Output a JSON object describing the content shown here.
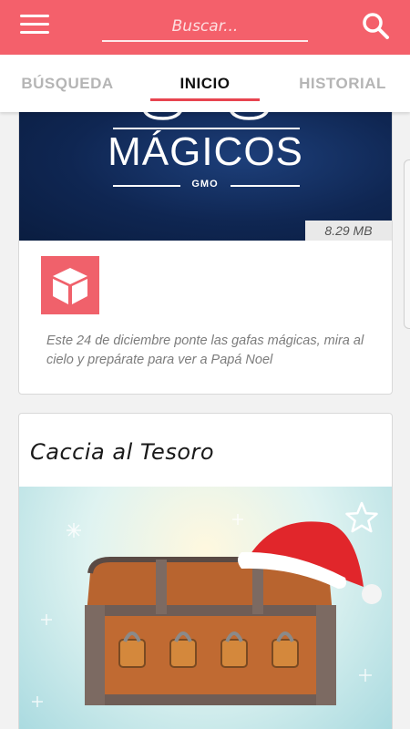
{
  "header": {
    "search_placeholder": "Buscar...",
    "menu_icon": "hamburger-menu-icon",
    "search_icon": "magnifier-icon"
  },
  "tabs": [
    {
      "label": "BÚSQUEDA",
      "active": false
    },
    {
      "label": "INICIO",
      "active": true
    },
    {
      "label": "HISTORIAL",
      "active": false
    }
  ],
  "colors": {
    "primary": "#f4606b",
    "indicator": "#e84450",
    "banner_blue": "#0f2652"
  },
  "cards": [
    {
      "banner_title": "MÁGICOS",
      "banner_subtitle": "GMO",
      "size": "8.29 MB",
      "icon": "cube-icon",
      "description": "Este 24 de diciembre ponte las gafas mágicas, mira al cielo y prepárate para ver a Papá Noel"
    },
    {
      "title": "Caccia al Tesoro",
      "favorite_icon": "star-outline-icon"
    }
  ]
}
